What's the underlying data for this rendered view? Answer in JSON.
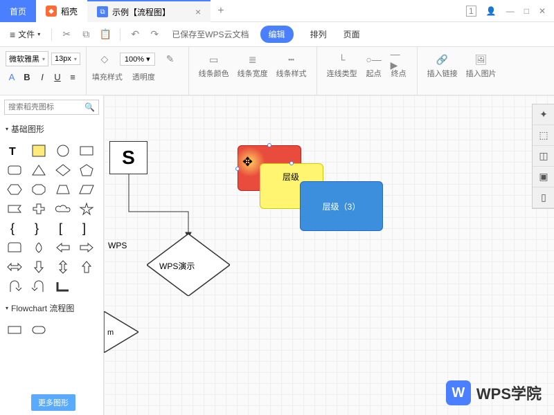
{
  "titlebar": {
    "home": "首页",
    "docktab": "稻壳",
    "active_tab": "示例【流程图】",
    "tab_close": "×",
    "add": "+",
    "badge": "1"
  },
  "menubar": {
    "file": "文件",
    "saved": "已保存至WPS云文档",
    "edit": "编辑",
    "arrange": "排列",
    "page": "页面"
  },
  "toolbar": {
    "font": "微软雅黑",
    "fontsize": "13px",
    "zoom": "100%",
    "fill": "填充样式",
    "opacity": "透明度",
    "linecolor": "线条颜色",
    "linewidth": "线条宽度",
    "linestyle": "线条样式",
    "conntype": "连线类型",
    "start": "起点",
    "end": "终点",
    "inslink": "插入链接",
    "insimg": "插入图片"
  },
  "sidebar": {
    "search_ph": "搜索稻壳图标",
    "cat1": "基础图形",
    "cat2": "Flowchart 流程图",
    "more": "更多图形"
  },
  "canvas": {
    "sbox": "S",
    "red": "层级",
    "yellow": "层级",
    "blue": "层级（3）",
    "diamond": "WPS演示",
    "wps": "WPS",
    "trilabel": "m"
  },
  "watermark": {
    "text": "WPS学院"
  }
}
